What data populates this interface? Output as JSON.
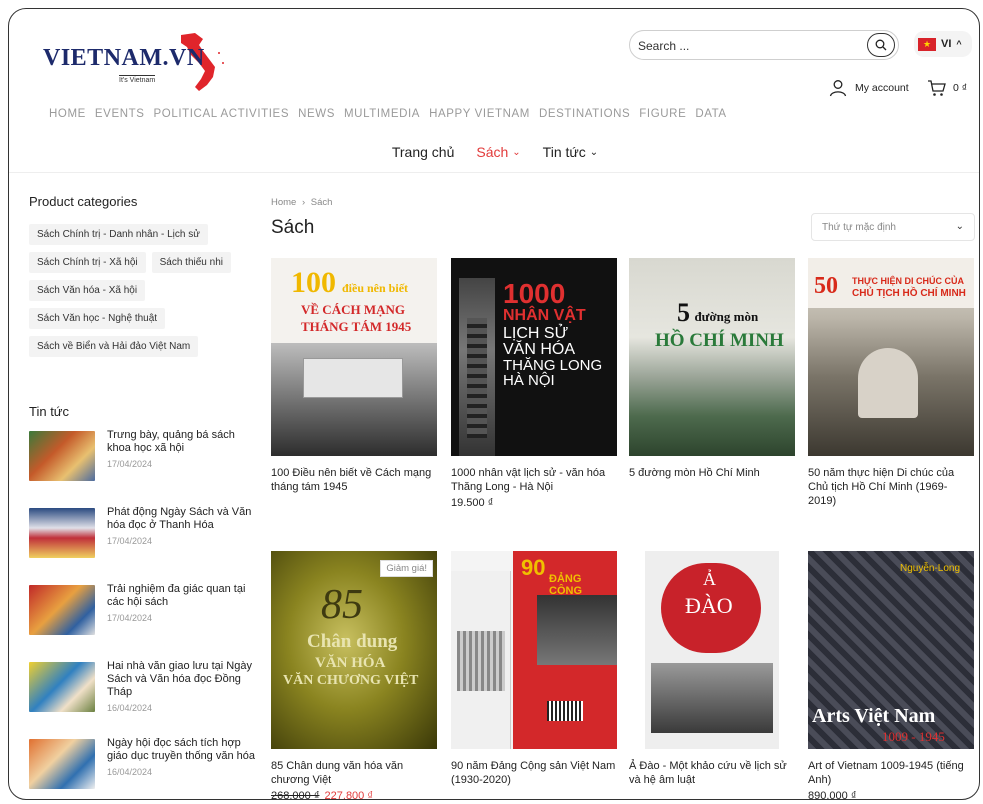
{
  "header": {
    "logo_text": "VIETNAM.VN",
    "logo_tagline": "It's Vietnam",
    "search_placeholder": "Search ...",
    "language": "VI",
    "account_label": "My account",
    "cart_total": "0 ₫"
  },
  "top_nav": [
    "HOME",
    "EVENTS",
    "POLITICAL ACTIVITIES",
    "NEWS",
    "MULTIMEDIA",
    "HAPPY VIETNAM",
    "DESTINATIONS",
    "FIGURE",
    "DATA"
  ],
  "sub_nav": {
    "home": "Trang chủ",
    "books": "Sách",
    "news": "Tin tức"
  },
  "sidebar": {
    "categories_title": "Product categories",
    "categories": [
      "Sách Chính trị - Danh nhân - Lịch sử",
      "Sách Chính trị - Xã hội",
      "Sách thiếu nhi",
      "Sách Văn hóa - Xã hội",
      "Sách Văn học - Nghệ thuật",
      "Sách về Biển và Hải đảo Việt Nam"
    ],
    "news_title": "Tin tức",
    "news": [
      {
        "title": "Trưng bày, quảng bá sách khoa học xã hội",
        "date": "17/04/2024"
      },
      {
        "title": "Phát động Ngày Sách và Văn hóa đọc ở Thanh Hóa",
        "date": "17/04/2024"
      },
      {
        "title": "Trải nghiệm đa giác quan tại các hội sách",
        "date": "17/04/2024"
      },
      {
        "title": "Hai nhà văn giao lưu tại Ngày Sách và Văn hóa đọc Đồng Tháp",
        "date": "16/04/2024"
      },
      {
        "title": "Ngày hội đọc sách tích hợp giáo dục truyền thống văn hóa",
        "date": "16/04/2024"
      }
    ]
  },
  "main": {
    "breadcrumb_home": "Home",
    "breadcrumb_sep": "›",
    "breadcrumb_current": "Sách",
    "title": "Sách",
    "sort_label": "Thứ tự mặc định",
    "sale_badge": "Giảm giá!",
    "products": [
      {
        "name": "100 Điều nên biết về Cách mạng tháng tám 1945",
        "price": ""
      },
      {
        "name": "1000 nhân vật lịch sử - văn hóa Thăng Long - Hà Nội",
        "price": "19.500 ₫"
      },
      {
        "name": "5 đường mòn Hồ Chí Minh",
        "price": ""
      },
      {
        "name": "50 năm thực hiện Di chúc của Chủ tịch Hồ Chí Minh (1969-2019)",
        "price": ""
      },
      {
        "name": "85 Chân dung văn hóa văn chương Việt",
        "old_price": "268.000 ₫",
        "price": "227.800 ₫"
      },
      {
        "name": "90 năm Đảng Cộng sản Việt Nam (1930-2020)",
        "price": ""
      },
      {
        "name": "Ả Đào - Một khảo cứu về lịch sử và hệ âm luật",
        "price": ""
      },
      {
        "name": "Art of Vietnam 1009-1945 (tiếng Anh)",
        "price": "890.000 ₫"
      }
    ],
    "covers": {
      "c1_line1": "100",
      "c1_line2": "điều nên biết",
      "c1_line3": "VỀ CÁCH MẠNG",
      "c1_line4": "THÁNG TÁM 1945",
      "c2_line1": "1000",
      "c2_line2": "NHÂN VẬT",
      "c2_line3": "LỊCH SỬ",
      "c2_line4": "VĂN HÓA",
      "c2_line5": "THĂNG LONG",
      "c2_line6": "HÀ NỘI",
      "c3_line1": "5",
      "c3_line2": "đường mòn",
      "c3_line3": "HỒ CHÍ MINH",
      "c4_line1": "50",
      "c4_line2": "THỰC HIỆN DI CHÚC CỦA",
      "c4_line3": "CHỦ TỊCH HỒ CHÍ MINH",
      "c5_line1": "85",
      "c5_line2": "Chân dung",
      "c5_line3": "VĂN HÓA",
      "c5_line4": "VĂN CHƯƠNG VIỆT",
      "c6_line1": "90",
      "c6_line2": "ĐẢNG CỘNG",
      "c7_line1": "Ả",
      "c7_line2": "ĐÀO",
      "c8_line1": "Nguyễn-Long",
      "c8_line2": "Arts Việt Nam",
      "c8_line3": "1009 - 1945"
    }
  },
  "colors": {
    "accent": "#e23b3b",
    "logo_blue": "#1d2a6b",
    "nav_gray": "#9a9a9a"
  }
}
